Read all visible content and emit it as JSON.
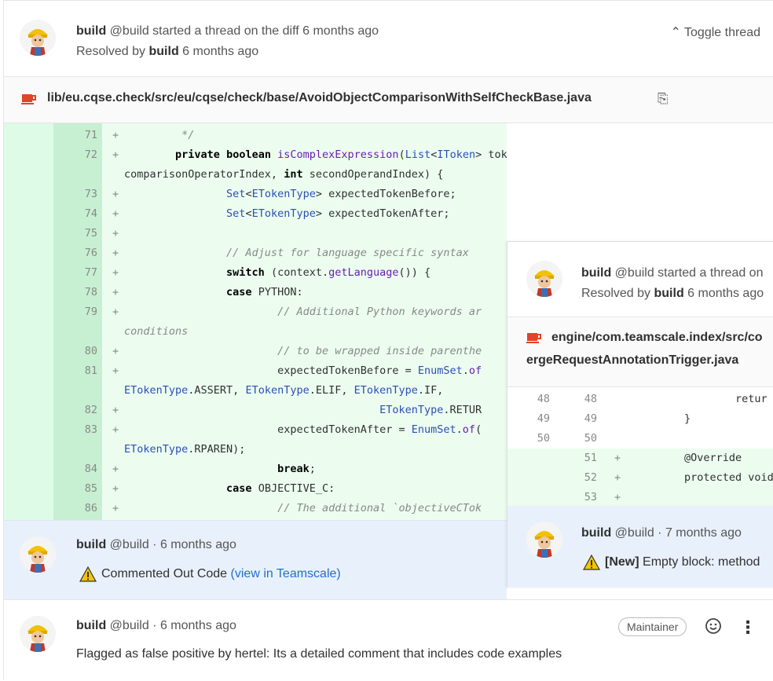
{
  "thread": {
    "author": "build",
    "handle": "@build",
    "action": "started a thread on the diff 6 months ago",
    "resolved_prefix": "Resolved by",
    "resolved_by": "build",
    "resolved_time": "6 months ago",
    "toggle_label": "Toggle thread",
    "file_path": "lib/eu.cqse.check/src/eu/cqse/check/base/AvoidObjectComparisonWithSelfCheckBase.java"
  },
  "code_lines": [
    {
      "n": "71",
      "text": "         */"
    },
    {
      "n": "72",
      "text": "        private boolean isComplexExpression(List<IToken> tokens, int"
    },
    {
      "n": "",
      "text": "comparisonOperatorIndex, int secondOperandIndex) {"
    },
    {
      "n": "73",
      "text": "                Set<ETokenType> expectedTokenBefore;"
    },
    {
      "n": "74",
      "text": "                Set<ETokenType> expectedTokenAfter;"
    },
    {
      "n": "75",
      "text": ""
    },
    {
      "n": "76",
      "text": "                // Adjust for language specific syntax"
    },
    {
      "n": "77",
      "text": "                switch (context.getLanguage()) {"
    },
    {
      "n": "78",
      "text": "                case PYTHON:"
    },
    {
      "n": "79",
      "text": "                        // Additional Python keywords ar"
    },
    {
      "n": "",
      "text": "conditions"
    },
    {
      "n": "80",
      "text": "                        // to be wrapped inside parenthe"
    },
    {
      "n": "81",
      "text": "                        expectedTokenBefore = EnumSet.of"
    },
    {
      "n": "",
      "text": "ETokenType.ASSERT, ETokenType.ELIF, ETokenType.IF,"
    },
    {
      "n": "82",
      "text": "                                        ETokenType.RETUR"
    },
    {
      "n": "83",
      "text": "                        expectedTokenAfter = EnumSet.of("
    },
    {
      "n": "",
      "text": "ETokenType.RPAREN);"
    },
    {
      "n": "84",
      "text": "                        break;"
    },
    {
      "n": "85",
      "text": "                case OBJECTIVE_C:"
    },
    {
      "n": "86",
      "text": "                        // The additional `objectiveCTok"
    }
  ],
  "note1": {
    "author": "build",
    "handle": "@build",
    "time": "· 6 months ago",
    "text": "Commented Out Code",
    "link": "(view in Teamscale)"
  },
  "note2": {
    "author": "build",
    "handle": "@build",
    "time": "· 6 months ago",
    "badge": "Maintainer",
    "text": "Flagged as false positive by hertel: Its a detailed comment that includes code examples"
  },
  "overlay": {
    "author": "build",
    "action": "@build started a thread on",
    "resolved_prefix": "Resolved by",
    "resolved_by": "build",
    "resolved_time": "6 months ago",
    "path1": "engine/com.teamscale.index/src/co",
    "path2": "ergeRequestAnnotationTrigger.java",
    "lines": [
      {
        "a": "48",
        "b": "48",
        "plus": "",
        "text": "                retur"
      },
      {
        "a": "49",
        "b": "49",
        "plus": "",
        "text": "        }"
      },
      {
        "a": "50",
        "b": "50",
        "plus": "",
        "text": ""
      },
      {
        "a": "",
        "b": "51",
        "plus": "+",
        "text": "        @Override"
      },
      {
        "a": "",
        "b": "52",
        "plus": "+",
        "text": "        protected void"
      },
      {
        "a": "",
        "b": "53",
        "plus": "+",
        "text": ""
      }
    ],
    "note_author": "build",
    "note_meta": "@build · 7 months ago",
    "note_tag": "[New]",
    "note_text": "Empty block: method"
  },
  "colors": {
    "added_bg": "#ecfdf0",
    "note_bg": "#e8f1fb",
    "link": "#1f6fd0",
    "warn": "#f5c400",
    "file_icon": "#e24329"
  }
}
